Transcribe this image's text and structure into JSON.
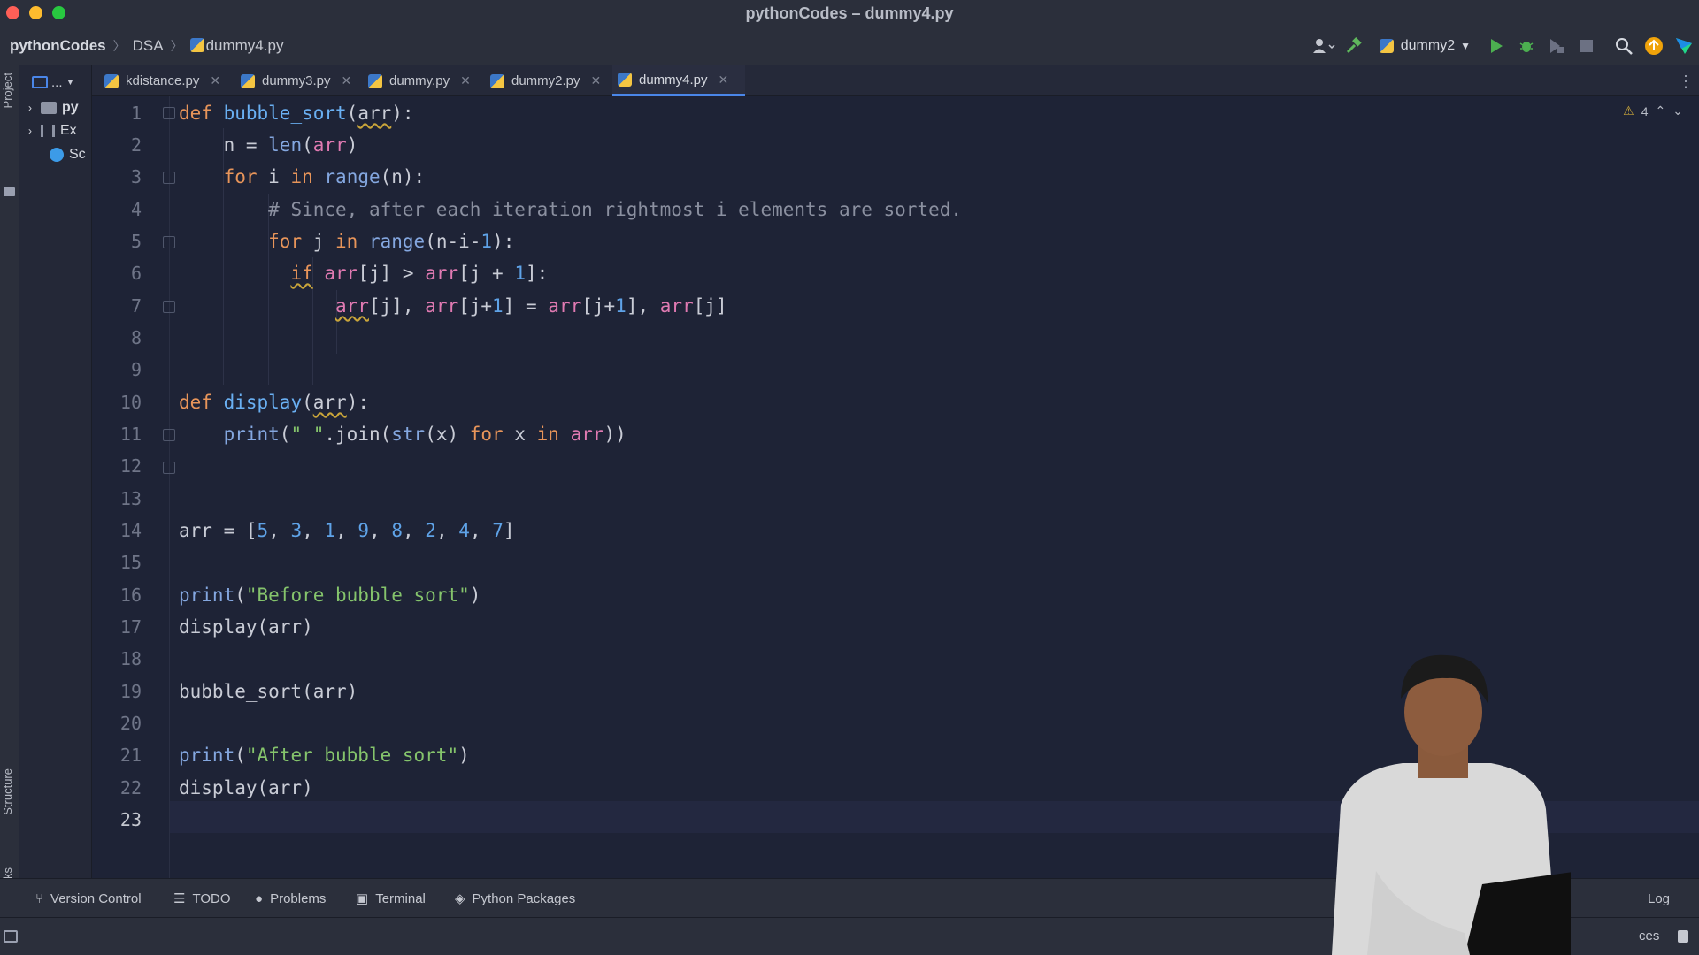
{
  "window": {
    "title": "pythonCodes – dummy4.py"
  },
  "breadcrumb": {
    "root": "pythonCodes",
    "folder": "DSA",
    "file": "dummy4.py"
  },
  "run_config": {
    "name": "dummy2"
  },
  "project_panel": {
    "header": "...",
    "items": [
      {
        "label": "py"
      },
      {
        "label": "Ex"
      },
      {
        "label": "Sc"
      }
    ]
  },
  "tabs": [
    {
      "label": "kdistance.py"
    },
    {
      "label": "dummy3.py"
    },
    {
      "label": "dummy.py"
    },
    {
      "label": "dummy2.py"
    },
    {
      "label": "dummy4.py",
      "active": true
    }
  ],
  "editor": {
    "warning_count": "4",
    "line_numbers": [
      "1",
      "2",
      "3",
      "4",
      "5",
      "6",
      "7",
      "8",
      "9",
      "10",
      "11",
      "12",
      "13",
      "14",
      "15",
      "16",
      "17",
      "18",
      "19",
      "20",
      "21",
      "22",
      "23"
    ],
    "current_line": "23"
  },
  "side_labels": {
    "project": "Project",
    "structure": "Structure",
    "bookmarks": "Bookmarks"
  },
  "bottom_tools": [
    {
      "label": "Version Control"
    },
    {
      "label": "TODO"
    },
    {
      "label": "Problems"
    },
    {
      "label": "Terminal"
    },
    {
      "label": "Python Packages"
    }
  ],
  "right_tools": {
    "event_log": "Log"
  },
  "status": {
    "services": "ces"
  },
  "colors": {
    "accent": "#4a86e8",
    "keyword": "#e8955a",
    "function": "#6ab0f3",
    "string": "#85c46c",
    "number": "#5fa3e8"
  }
}
